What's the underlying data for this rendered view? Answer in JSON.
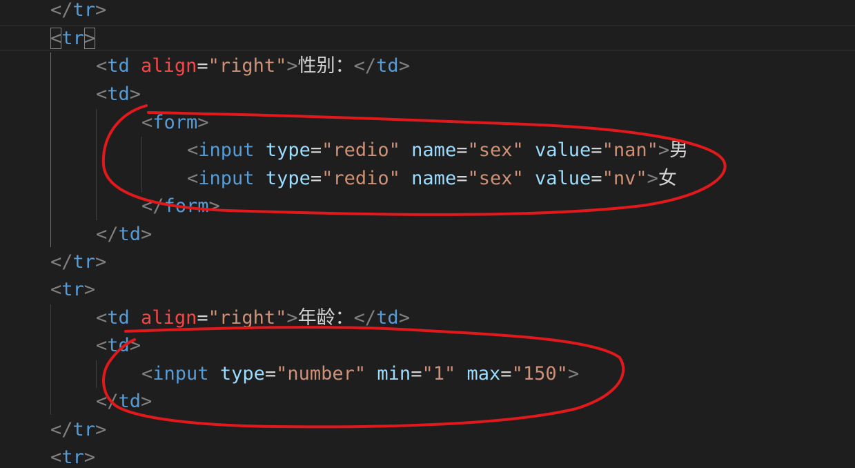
{
  "editor": {
    "lines": [
      [
        {
          "t": "</",
          "k": "punct"
        },
        {
          "t": "tr",
          "k": "tag"
        },
        {
          "t": ">",
          "k": "punct"
        }
      ],
      [
        {
          "t": "<",
          "k": "punct",
          "hl": true
        },
        {
          "t": "tr",
          "k": "tag"
        },
        {
          "t": ">",
          "k": "punct",
          "hl": true
        }
      ],
      [
        {
          "t": "<",
          "k": "punct"
        },
        {
          "t": "td",
          "k": "tag"
        },
        {
          "t": " ",
          "k": "eq"
        },
        {
          "t": "align",
          "k": "err"
        },
        {
          "t": "=",
          "k": "eq"
        },
        {
          "t": "\"right\"",
          "k": "str"
        },
        {
          "t": ">",
          "k": "punct"
        },
        {
          "t": "性别：",
          "k": "text"
        },
        {
          "t": "</",
          "k": "punct"
        },
        {
          "t": "td",
          "k": "tag"
        },
        {
          "t": ">",
          "k": "punct"
        }
      ],
      [
        {
          "t": "<",
          "k": "punct"
        },
        {
          "t": "td",
          "k": "tag"
        },
        {
          "t": ">",
          "k": "punct"
        }
      ],
      [
        {
          "t": "<",
          "k": "punct"
        },
        {
          "t": "form",
          "k": "tag"
        },
        {
          "t": ">",
          "k": "punct"
        }
      ],
      [
        {
          "t": "<",
          "k": "punct"
        },
        {
          "t": "input",
          "k": "tag"
        },
        {
          "t": " ",
          "k": "eq"
        },
        {
          "t": "type",
          "k": "attr"
        },
        {
          "t": "=",
          "k": "eq"
        },
        {
          "t": "\"redio\"",
          "k": "str"
        },
        {
          "t": " ",
          "k": "eq"
        },
        {
          "t": "name",
          "k": "attr"
        },
        {
          "t": "=",
          "k": "eq"
        },
        {
          "t": "\"sex\"",
          "k": "str"
        },
        {
          "t": " ",
          "k": "eq"
        },
        {
          "t": "value",
          "k": "attr"
        },
        {
          "t": "=",
          "k": "eq"
        },
        {
          "t": "\"nan\"",
          "k": "str"
        },
        {
          "t": ">",
          "k": "punct"
        },
        {
          "t": "男",
          "k": "text"
        }
      ],
      [
        {
          "t": "<",
          "k": "punct"
        },
        {
          "t": "input",
          "k": "tag"
        },
        {
          "t": " ",
          "k": "eq"
        },
        {
          "t": "type",
          "k": "attr"
        },
        {
          "t": "=",
          "k": "eq"
        },
        {
          "t": "\"redio\"",
          "k": "str"
        },
        {
          "t": " ",
          "k": "eq"
        },
        {
          "t": "name",
          "k": "attr"
        },
        {
          "t": "=",
          "k": "eq"
        },
        {
          "t": "\"sex\"",
          "k": "str"
        },
        {
          "t": " ",
          "k": "eq"
        },
        {
          "t": "value",
          "k": "attr"
        },
        {
          "t": "=",
          "k": "eq"
        },
        {
          "t": "\"nv\"",
          "k": "str"
        },
        {
          "t": ">",
          "k": "punct"
        },
        {
          "t": "女",
          "k": "text"
        }
      ],
      [
        {
          "t": "</",
          "k": "punct"
        },
        {
          "t": "form",
          "k": "tag"
        },
        {
          "t": ">",
          "k": "punct"
        }
      ],
      [
        {
          "t": "</",
          "k": "punct"
        },
        {
          "t": "td",
          "k": "tag"
        },
        {
          "t": ">",
          "k": "punct"
        }
      ],
      [
        {
          "t": "</",
          "k": "punct"
        },
        {
          "t": "tr",
          "k": "tag"
        },
        {
          "t": ">",
          "k": "punct"
        }
      ],
      [
        {
          "t": "<",
          "k": "punct"
        },
        {
          "t": "tr",
          "k": "tag"
        },
        {
          "t": ">",
          "k": "punct"
        }
      ],
      [
        {
          "t": "<",
          "k": "punct"
        },
        {
          "t": "td",
          "k": "tag"
        },
        {
          "t": " ",
          "k": "eq"
        },
        {
          "t": "align",
          "k": "err"
        },
        {
          "t": "=",
          "k": "eq"
        },
        {
          "t": "\"right\"",
          "k": "str"
        },
        {
          "t": ">",
          "k": "punct"
        },
        {
          "t": "年龄：",
          "k": "text"
        },
        {
          "t": "</",
          "k": "punct"
        },
        {
          "t": "td",
          "k": "tag"
        },
        {
          "t": ">",
          "k": "punct"
        }
      ],
      [
        {
          "t": "<",
          "k": "punct"
        },
        {
          "t": "td",
          "k": "tag"
        },
        {
          "t": ">",
          "k": "punct"
        }
      ],
      [
        {
          "t": "<",
          "k": "punct"
        },
        {
          "t": "input",
          "k": "tag"
        },
        {
          "t": " ",
          "k": "eq"
        },
        {
          "t": "type",
          "k": "attr"
        },
        {
          "t": "=",
          "k": "eq"
        },
        {
          "t": "\"number\"",
          "k": "str"
        },
        {
          "t": " ",
          "k": "eq"
        },
        {
          "t": "min",
          "k": "attr"
        },
        {
          "t": "=",
          "k": "eq"
        },
        {
          "t": "\"1\"",
          "k": "str"
        },
        {
          "t": " ",
          "k": "eq"
        },
        {
          "t": "max",
          "k": "attr"
        },
        {
          "t": "=",
          "k": "eq"
        },
        {
          "t": "\"150\"",
          "k": "str"
        },
        {
          "t": ">",
          "k": "punct"
        }
      ],
      [
        {
          "t": "</",
          "k": "punct"
        },
        {
          "t": "td",
          "k": "tag"
        },
        {
          "t": ">",
          "k": "punct"
        }
      ],
      [
        {
          "t": "</",
          "k": "punct"
        },
        {
          "t": "tr",
          "k": "tag"
        },
        {
          "t": ">",
          "k": "punct"
        }
      ],
      [
        {
          "t": "<",
          "k": "punct"
        },
        {
          "t": "tr",
          "k": "tag"
        },
        {
          "t": ">",
          "k": "punct"
        }
      ]
    ]
  },
  "annotation_color": "#e0191c"
}
